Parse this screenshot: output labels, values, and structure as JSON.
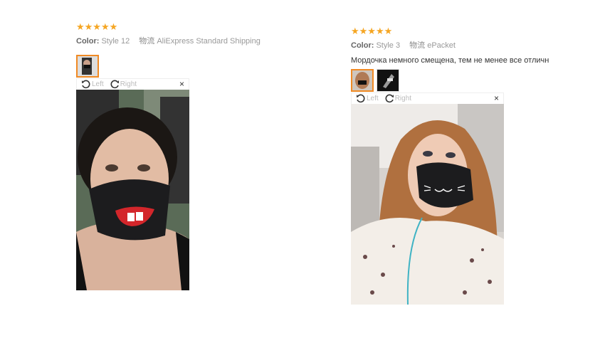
{
  "reviews": [
    {
      "stars": "★★★★★",
      "color_label": "Color:",
      "color_value": "Style 12",
      "shipping_label": "物流",
      "shipping_value": "AliExpress Standard Shipping",
      "viewer": {
        "left_label": "Left",
        "right_label": "Right",
        "close_label": "×"
      }
    },
    {
      "stars": "★★★★★",
      "color_label": "Color:",
      "color_value": "Style 3",
      "shipping_label": "物流",
      "shipping_value": "ePacket",
      "comment": "Мордочка немного смещена, тем не менее все отличн",
      "viewer": {
        "left_label": "Left",
        "right_label": "Right",
        "close_label": "×"
      }
    }
  ],
  "colors": {
    "star": "#f5a623",
    "selected_border": "#f08a24",
    "mask": "#1c1c1e"
  }
}
